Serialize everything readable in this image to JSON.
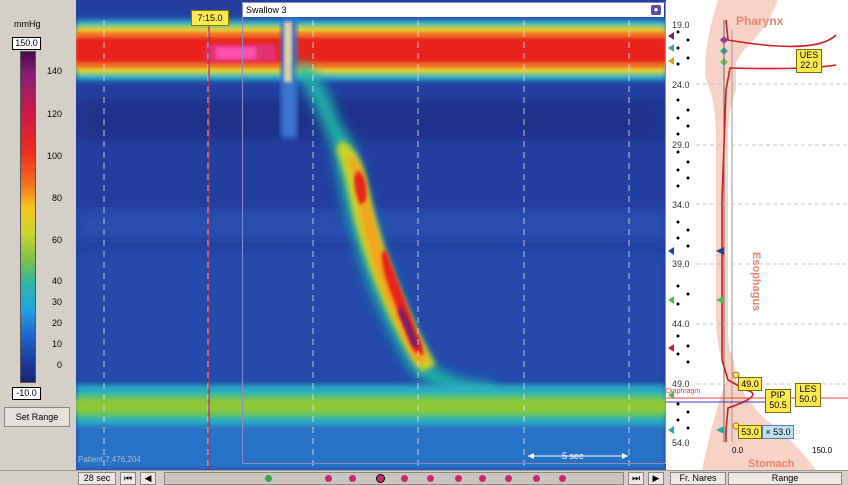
{
  "legend": {
    "unit": "mmHg",
    "max_value": "150.0",
    "min_value": "-10.0",
    "ticks": [
      "140",
      "120",
      "100",
      "80",
      "60",
      "40",
      "30",
      "20",
      "10",
      "0"
    ],
    "set_range_label": "Set Range"
  },
  "plot": {
    "time_marker": "7:15.0",
    "swallow_title": "Swallow 3",
    "patient": "Patient 7,476,204",
    "scale_label": "5 sec"
  },
  "anatomy": {
    "depths": [
      "19.0",
      "24.0",
      "29.0",
      "34.0",
      "39.0",
      "44.0",
      "49.0",
      "54.0"
    ],
    "pharynx_label": "Pharynx",
    "esophagus_label": "Esophagus",
    "stomach_label": "Stomach",
    "diaphragm_label": "Diaphragm",
    "ues_label": "UES",
    "ues_value": "22.0",
    "les_label": "LES",
    "les_value": "50.0",
    "pip_label": "PIP",
    "pip_value": "50.5",
    "marker_49": "49.0",
    "marker_53": "53.0",
    "marker_53_alt": "53.0",
    "axis_min": "0.0",
    "axis_max": "150.0"
  },
  "bottom": {
    "duration": "28 sec",
    "fr_nares_label": "Fr. Nares",
    "range_label": "Range"
  },
  "colors": {
    "background_plot": "#223f9f",
    "ues_band": "#e8231f",
    "anatomy_shape": "#f8d2c6",
    "accent_yellow": "#ffe94f"
  }
}
